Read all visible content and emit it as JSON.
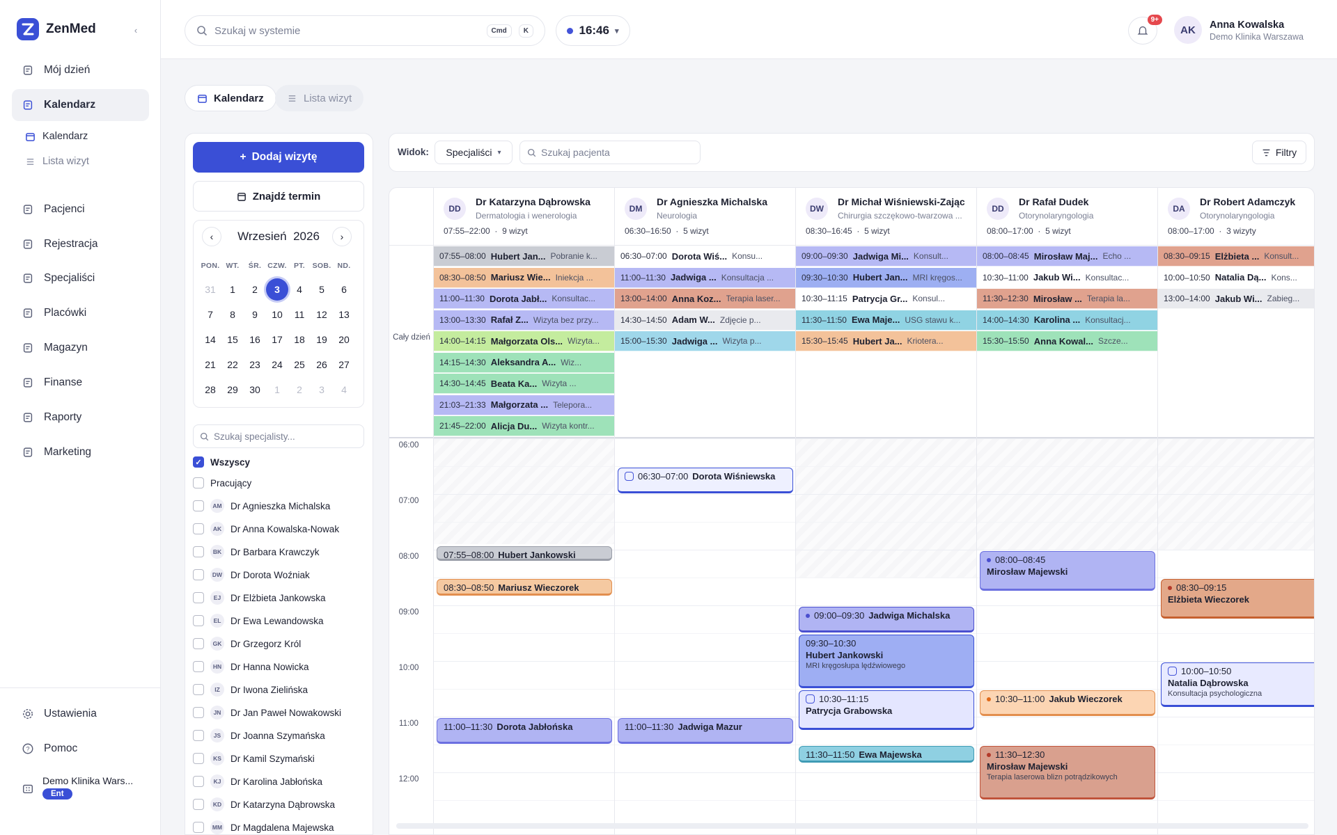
{
  "app": {
    "name": "ZenMed"
  },
  "sidebar": {
    "items": [
      {
        "label": "Mój dzień"
      },
      {
        "label": "Kalendarz"
      },
      {
        "label": "Pacjenci"
      },
      {
        "label": "Rejestracja"
      },
      {
        "label": "Specjaliści"
      },
      {
        "label": "Placówki"
      },
      {
        "label": "Magazyn"
      },
      {
        "label": "Finanse"
      },
      {
        "label": "Raporty"
      },
      {
        "label": "Marketing"
      }
    ],
    "sub_items": [
      {
        "label": "Kalendarz"
      },
      {
        "label": "Lista wizyt"
      }
    ],
    "bottom": [
      {
        "label": "Ustawienia"
      },
      {
        "label": "Pomoc"
      }
    ],
    "org": {
      "name": "Demo Klinika Wars...",
      "plan": "Ent"
    }
  },
  "topbar": {
    "search_placeholder": "Szukaj w systemie",
    "kbd1": "Cmd",
    "kbd2": "K",
    "time": "16:46",
    "notif_count": "9+",
    "user": {
      "initials": "AK",
      "name": "Anna Kowalska",
      "org": "Demo Klinika Warszawa"
    }
  },
  "tabs": [
    {
      "label": "Kalendarz"
    },
    {
      "label": "Lista wizyt"
    }
  ],
  "left": {
    "add_label": "Dodaj wizytę",
    "find_label": "Znajdź termin",
    "month": "Wrzesień",
    "year": "2026",
    "dow": [
      "PON.",
      "WT.",
      "ŚR.",
      "CZW.",
      "PT.",
      "SOB.",
      "ND."
    ],
    "weeks": [
      [
        "31",
        "1",
        "2",
        "3",
        "4",
        "5",
        "6"
      ],
      [
        "7",
        "8",
        "9",
        "10",
        "11",
        "12",
        "13"
      ],
      [
        "14",
        "15",
        "16",
        "17",
        "18",
        "19",
        "20"
      ],
      [
        "21",
        "22",
        "23",
        "24",
        "25",
        "26",
        "27"
      ],
      [
        "28",
        "29",
        "30",
        "1",
        "2",
        "3",
        "4"
      ]
    ],
    "spec_search_placeholder": "Szukaj specjalisty...",
    "filter_all": "Wszyscy",
    "filter_working": "Pracujący",
    "specialists": [
      {
        "initials": "AM",
        "name": "Dr Agnieszka Michalska"
      },
      {
        "initials": "AK",
        "name": "Dr Anna Kowalska-Nowak"
      },
      {
        "initials": "BK",
        "name": "Dr Barbara Krawczyk"
      },
      {
        "initials": "DW",
        "name": "Dr Dorota Woźniak"
      },
      {
        "initials": "EJ",
        "name": "Dr Elżbieta Jankowska"
      },
      {
        "initials": "EL",
        "name": "Dr Ewa Lewandowska"
      },
      {
        "initials": "GK",
        "name": "Dr Grzegorz Król"
      },
      {
        "initials": "HN",
        "name": "Dr Hanna Nowicka"
      },
      {
        "initials": "IZ",
        "name": "Dr Iwona Zielińska"
      },
      {
        "initials": "JN",
        "name": "Dr Jan Paweł Nowakowski"
      },
      {
        "initials": "JS",
        "name": "Dr Joanna Szymańska"
      },
      {
        "initials": "KS",
        "name": "Dr Kamil Szymański"
      },
      {
        "initials": "KJ",
        "name": "Dr Karolina Jabłońska"
      },
      {
        "initials": "KD",
        "name": "Dr Katarzyna Dąbrowska"
      },
      {
        "initials": "MM",
        "name": "Dr Magdalena Majewska"
      }
    ]
  },
  "toolbar": {
    "view_label": "Widok:",
    "view_value": "Specjaliści",
    "patient_search": "Szukaj pacjenta",
    "filters": "Filtry"
  },
  "grid": {
    "allday_label": "Cały dzień",
    "hours": [
      "06:00",
      "07:00",
      "08:00",
      "09:00",
      "10:00",
      "11:00",
      "12:00"
    ],
    "columns": [
      {
        "initials": "DD",
        "name": "Dr Katarzyna Dąbrowska",
        "spec": "Dermatologia i wenerologia",
        "hours": "07:55–22:00",
        "count": "9 wizyt",
        "allday": [
          {
            "time": "07:55–08:00",
            "name": "Hubert Jan...",
            "desc": "Pobranie k...",
            "color": "#c9ccd3"
          },
          {
            "time": "08:30–08:50",
            "name": "Mariusz Wie...",
            "desc": "Iniekcja ...",
            "color": "#f3c29a"
          },
          {
            "time": "11:00–11:30",
            "name": "Dorota Jabł...",
            "desc": "Konsultac...",
            "color": "#b6b9f4"
          },
          {
            "time": "13:00–13:30",
            "name": "Rafał Z...",
            "desc": "Wizyta bez przy...",
            "color": "#b6b9f4"
          },
          {
            "time": "14:00–14:15",
            "name": "Małgorzata Ols...",
            "desc": "Wizyta...",
            "color": "#c4ec9e"
          },
          {
            "time": "14:15–14:30",
            "name": "Aleksandra A...",
            "desc": "Wiz...",
            "color": "#9ee2b9"
          },
          {
            "time": "14:30–14:45",
            "name": "Beata Ka...",
            "desc": "Wizyta ...",
            "color": "#9ee2b9"
          },
          {
            "time": "21:03–21:33",
            "name": "Małgorzata ...",
            "desc": "Telepora...",
            "color": "#b6b9f4"
          },
          {
            "time": "21:45–22:00",
            "name": "Alicja Du...",
            "desc": "Wizyta kontr...",
            "color": "#9ee2b9"
          }
        ]
      },
      {
        "initials": "DM",
        "name": "Dr Agnieszka Michalska",
        "spec": "Neurologia",
        "hours": "06:30–16:50",
        "count": "5 wizyt",
        "allday": [
          {
            "time": "06:30–07:00",
            "name": "Dorota Wiś...",
            "desc": "Konsu...",
            "color": "#ffffff"
          },
          {
            "time": "11:00–11:30",
            "name": "Jadwiga ...",
            "desc": "Konsultacja ...",
            "color": "#b6b9f4"
          },
          {
            "time": "13:00–14:00",
            "name": "Anna Koz...",
            "desc": "Terapia laser...",
            "color": "#e0a28e"
          },
          {
            "time": "14:30–14:50",
            "name": "Adam W...",
            "desc": "Zdjęcie p...",
            "color": "#e9eaee"
          },
          {
            "time": "15:00–15:30",
            "name": "Jadwiga ...",
            "desc": "Wizyta p...",
            "color": "#9fd7ea"
          }
        ]
      },
      {
        "initials": "DW",
        "name": "Dr Michał Wiśniewski-Zając",
        "spec": "Chirurgia szczękowo-twarzowa ...",
        "hours": "08:30–16:45",
        "count": "5 wizyt",
        "allday": [
          {
            "time": "09:00–09:30",
            "name": "Jadwiga Mi...",
            "desc": "Konsult...",
            "color": "#b6b9f4"
          },
          {
            "time": "09:30–10:30",
            "name": "Hubert Jan...",
            "desc": "MRI kręgos...",
            "color": "#9daff2"
          },
          {
            "time": "10:30–11:15",
            "name": "Patrycja Gr...",
            "desc": "Konsul...",
            "color": "#ffffff"
          },
          {
            "time": "11:30–11:50",
            "name": "Ewa Maje...",
            "desc": "USG stawu k...",
            "color": "#90d3e3"
          },
          {
            "time": "15:30–15:45",
            "name": "Hubert Ja...",
            "desc": "Kriotera...",
            "color": "#f3c29a"
          }
        ]
      },
      {
        "initials": "DD",
        "name": "Dr Rafał Dudek",
        "spec": "Otorynolaryngologia",
        "hours": "08:00–17:00",
        "count": "5 wizyt",
        "allday": [
          {
            "time": "08:00–08:45",
            "name": "Mirosław Maj...",
            "desc": "Echo ...",
            "color": "#b6b9f4"
          },
          {
            "time": "10:30–11:00",
            "name": "Jakub Wi...",
            "desc": "Konsultac...",
            "color": "#ffffff"
          },
          {
            "time": "11:30–12:30",
            "name": "Mirosław ...",
            "desc": "Terapia la...",
            "color": "#e0a28e"
          },
          {
            "time": "14:00–14:30",
            "name": "Karolina ...",
            "desc": "Konsultacj...",
            "color": "#90d3e3"
          },
          {
            "time": "15:30–15:50",
            "name": "Anna Kowal...",
            "desc": "Szcze...",
            "color": "#9ee2b9"
          }
        ]
      },
      {
        "initials": "DA",
        "name": "Dr Robert Adamczyk",
        "spec": "Otorynolaryngologia",
        "hours": "08:00–17:00",
        "count": "3 wizyty",
        "allday": [
          {
            "time": "08:30–09:15",
            "name": "Elżbieta ...",
            "desc": "Konsult...",
            "color": "#e0a28e"
          },
          {
            "time": "10:00–10:50",
            "name": "Natalia Dą...",
            "desc": "Kons...",
            "color": "#ffffff"
          },
          {
            "time": "13:00–14:00",
            "name": "Jakub Wi...",
            "desc": "Zabieg...",
            "color": "#e9eaee"
          }
        ]
      }
    ],
    "events": [
      {
        "col": 0,
        "start": "07:55",
        "end": "08:00",
        "time": "07:55–08:00",
        "name": "Hubert Jankowski",
        "desc": "",
        "bg": "#c9ccd3",
        "border": "#9a9ea8",
        "layout": "inline"
      },
      {
        "col": 0,
        "start": "08:30",
        "end": "08:50",
        "time": "08:30–08:50",
        "name": "Mariusz Wieczorek",
        "desc": "",
        "bg": "#f5c9a1",
        "border": "#e28e4e",
        "layout": "inline"
      },
      {
        "col": 0,
        "start": "11:00",
        "end": "11:30",
        "time": "11:00–11:30",
        "name": "Dorota Jabłońska",
        "desc": "",
        "bg": "#b0b4f3",
        "border": "#6b6fe0",
        "layout": "inline"
      },
      {
        "col": 1,
        "start": "06:30",
        "end": "07:00",
        "time": "06:30–07:00",
        "name": "Dorota Wiśniewska",
        "desc": "",
        "bg": "#eef0ff",
        "border": "#3a4fd6",
        "layout": "inline",
        "icon": true
      },
      {
        "col": 1,
        "start": "11:00",
        "end": "11:30",
        "time": "11:00–11:30",
        "name": "Jadwiga Mazur",
        "desc": "",
        "bg": "#b0b4f3",
        "border": "#6b6fe0",
        "layout": "inline"
      },
      {
        "col": 2,
        "start": "09:00",
        "end": "09:30",
        "time": "09:00–09:30",
        "name": "Jadwiga Michalska",
        "desc": "",
        "bg": "#b0b4f3",
        "border": "#4a4fcf",
        "layout": "inline",
        "dot": "#4a4fcf"
      },
      {
        "col": 2,
        "start": "09:30",
        "end": "10:30",
        "time": "09:30–10:30",
        "name": "Hubert Jankowski",
        "desc": "MRI kręgosłupa lędźwiowego",
        "bg": "#9eaef3",
        "border": "#3a4fd6",
        "layout": "block"
      },
      {
        "col": 2,
        "start": "10:30",
        "end": "11:15",
        "time": "10:30–11:15",
        "name": "Patrycja Grabowska",
        "desc": "",
        "bg": "#e4e6ff",
        "border": "#3a4fd6",
        "layout": "block",
        "icon": true
      },
      {
        "col": 2,
        "start": "11:30",
        "end": "11:50",
        "time": "11:30–11:50",
        "name": "Ewa Majewska",
        "desc": "",
        "bg": "#8fd0e2",
        "border": "#3f9bb5",
        "layout": "inline"
      },
      {
        "col": 3,
        "start": "08:00",
        "end": "08:45",
        "time": "08:00–08:45",
        "name": "Mirosław Majewski",
        "desc": "",
        "bg": "#b0b4f3",
        "border": "#6b6fe0",
        "layout": "block",
        "dot": "#4a4fcf"
      },
      {
        "col": 3,
        "start": "10:30",
        "end": "11:00",
        "time": "10:30–11:00",
        "name": "Jakub Wieczorek",
        "desc": "",
        "bg": "#fcd5b3",
        "border": "#e28e4e",
        "layout": "inline",
        "dot": "#e06a1a"
      },
      {
        "col": 3,
        "start": "11:30",
        "end": "12:30",
        "time": "11:30–12:30",
        "name": "Mirosław Majewski",
        "desc": "Terapia laserowa blizn potrądzikowych",
        "bg": "#d9a08e",
        "border": "#c0533a",
        "layout": "block",
        "dot": "#b33a2a"
      },
      {
        "col": 4,
        "start": "08:30",
        "end": "09:15",
        "time": "08:30–09:15",
        "name": "Elżbieta Wieczorek",
        "desc": "",
        "bg": "#e3a889",
        "border": "#c6602f",
        "layout": "block",
        "dot": "#b33a2a"
      },
      {
        "col": 4,
        "start": "10:00",
        "end": "10:50",
        "time": "10:00–10:50",
        "name": "Natalia Dąbrowska",
        "desc": "Konsultacja psychologiczna",
        "bg": "#e8eaff",
        "border": "#3a4fd6",
        "layout": "block",
        "icon": true
      }
    ]
  }
}
